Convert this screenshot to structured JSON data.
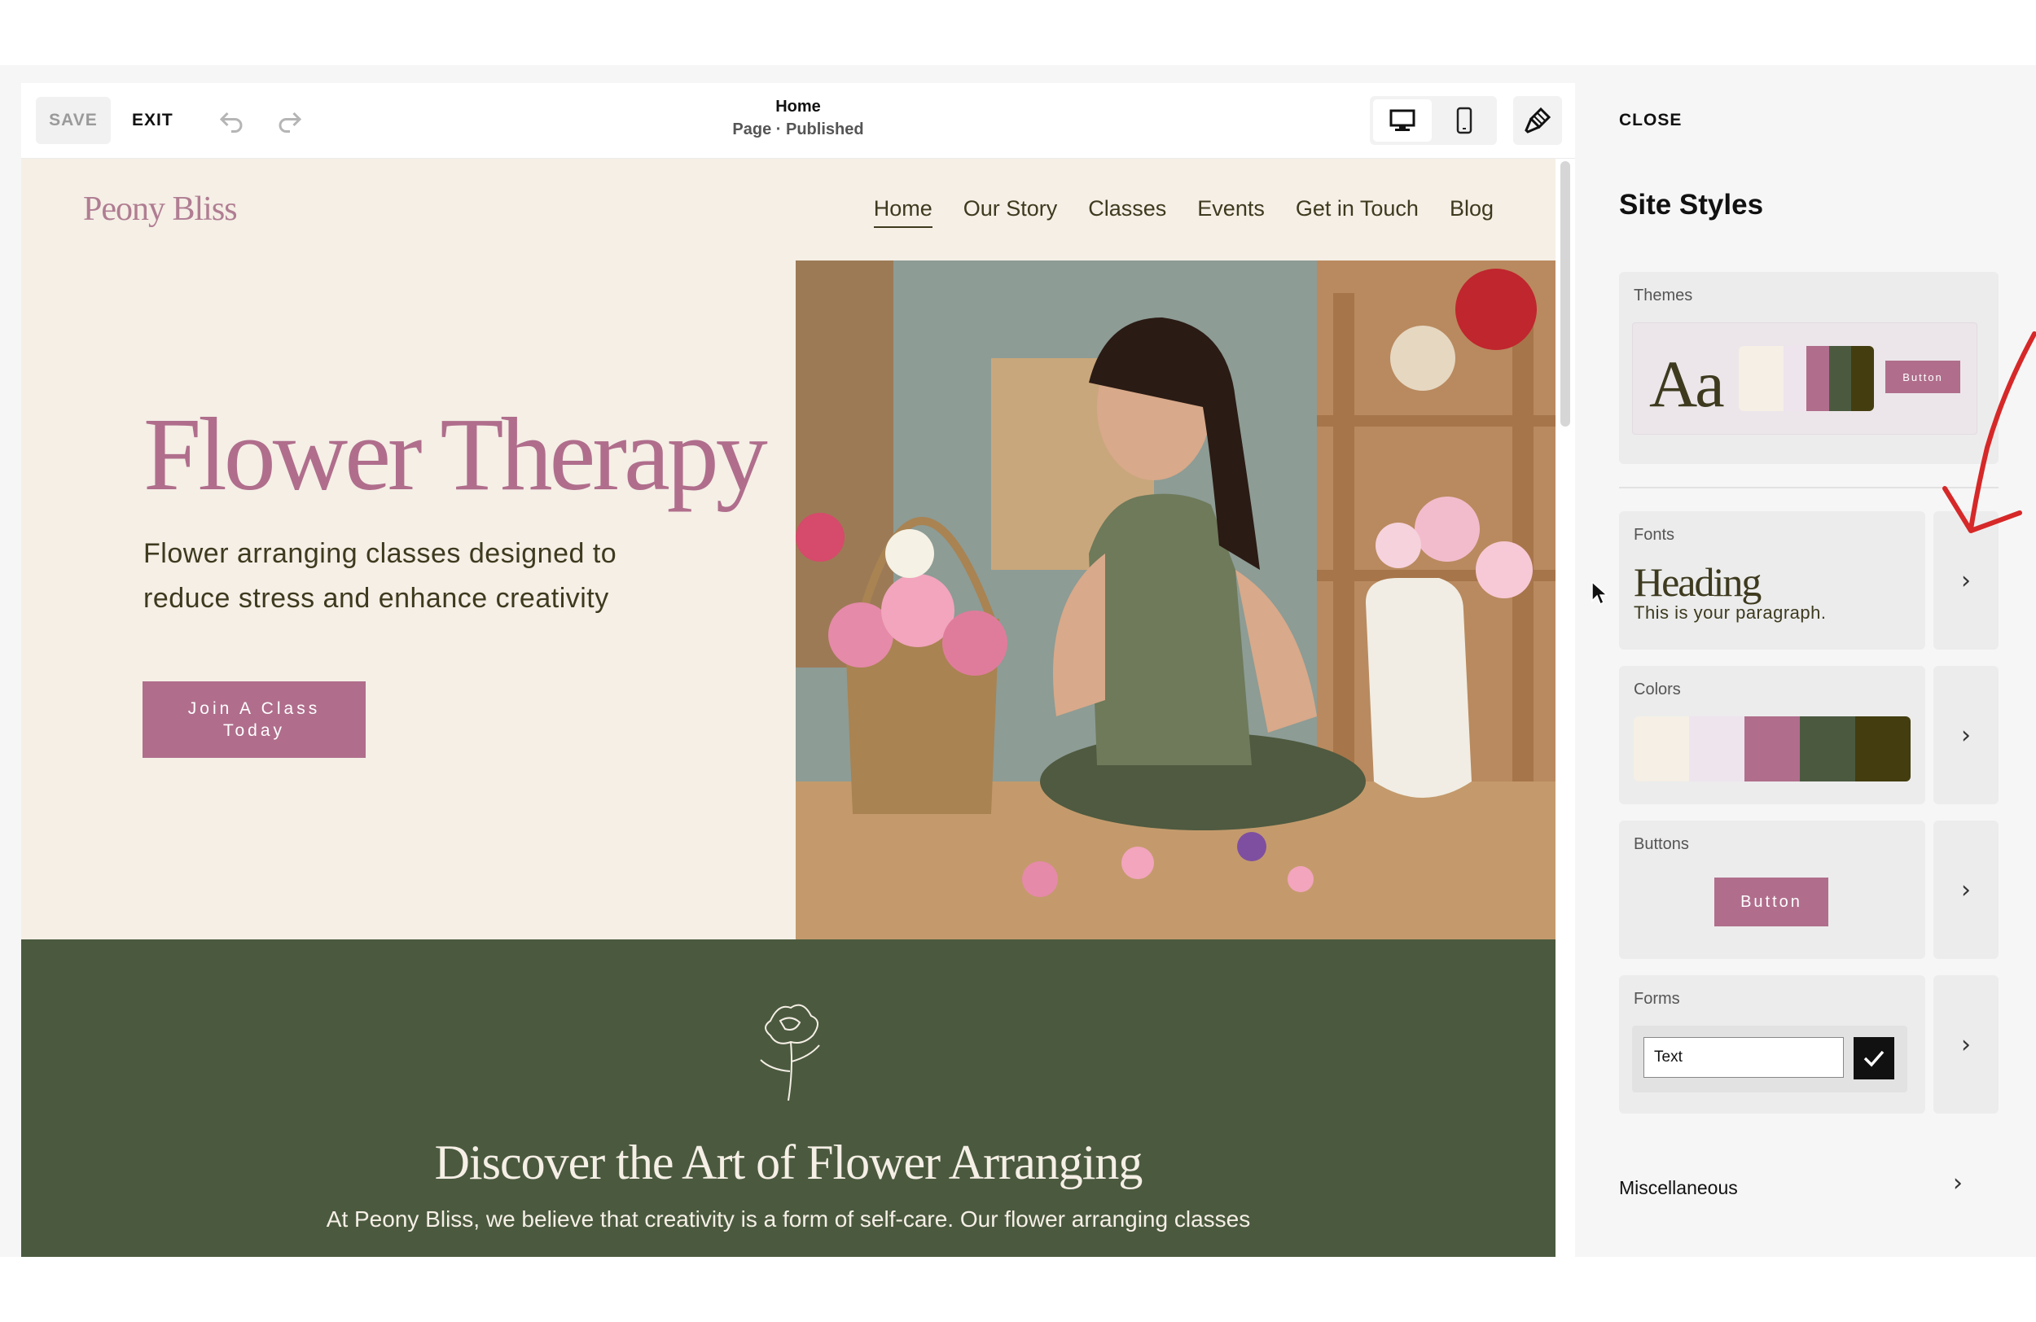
{
  "editor": {
    "save_label": "SAVE",
    "exit_label": "EXIT",
    "page_title": "Home",
    "page_status": "Page · Published"
  },
  "site": {
    "logo": "Peony Bliss",
    "nav": [
      "Home",
      "Our Story",
      "Classes",
      "Events",
      "Get in Touch",
      "Blog"
    ],
    "hero_title": "Flower Therapy",
    "hero_subtitle": "Flower arranging classes designed to reduce stress and enhance creativity",
    "hero_cta": "Join A Class Today",
    "section_title": "Discover the Art of Flower Arranging",
    "section_body": "At Peony Bliss, we believe that creativity is a form of self-care. Our flower arranging classes"
  },
  "panel": {
    "close_label": "CLOSE",
    "title": "Site Styles",
    "themes": {
      "label": "Themes",
      "sample_text": "Aa",
      "sample_button": "Button"
    },
    "fonts": {
      "label": "Fonts",
      "heading": "Heading",
      "paragraph": "This is your paragraph."
    },
    "colors": {
      "label": "Colors"
    },
    "buttons": {
      "label": "Buttons",
      "sample_button": "Button"
    },
    "forms": {
      "label": "Forms",
      "text_value": "Text"
    },
    "misc_label": "Miscellaneous"
  },
  "palette": [
    "#f5efe6",
    "#ede4ee",
    "#b06e8c",
    "#4b5a3f",
    "#433d10"
  ],
  "icons": [
    "undo-icon",
    "redo-icon",
    "desktop-icon",
    "mobile-icon",
    "paintbrush-icon",
    "chevron-right-icon",
    "checkmark-icon",
    "peony-flower-icon"
  ]
}
